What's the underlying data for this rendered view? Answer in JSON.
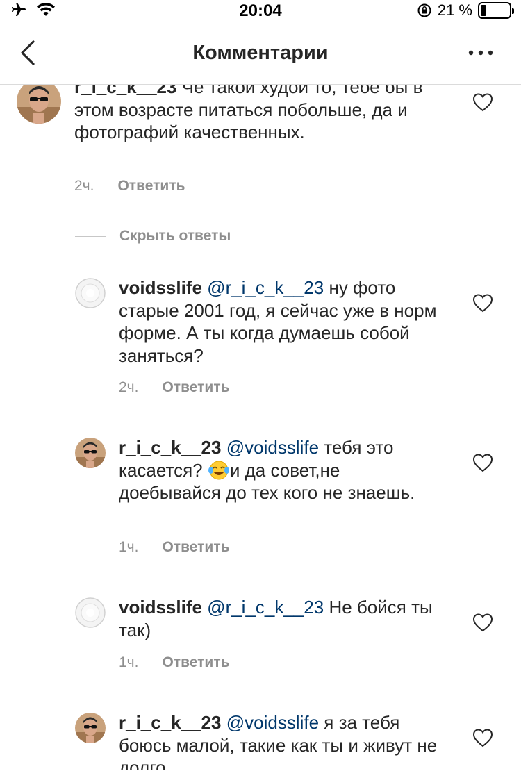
{
  "status_bar": {
    "time": "20:04",
    "battery_text": "21 %",
    "battery_level": 0.21,
    "icons": [
      "airplane-icon",
      "wifi-icon",
      "orientation-lock-icon",
      "battery-icon"
    ]
  },
  "header": {
    "title": "Комментарии",
    "back_icon": "chevron-left-icon",
    "more_icon": "more-horizontal-icon"
  },
  "comments": [
    {
      "username": "r_i_c_k__23",
      "mention": "",
      "text": " Че такой худой то, тебе бы в этом возрасте питаться побольше, да и фотографий качественных.",
      "time": "2ч.",
      "reply_label": "Ответить"
    }
  ],
  "hide_replies_label": "Скрыть ответы",
  "replies": [
    {
      "username": "voidsslife",
      "mention": "@r_i_c_k__23",
      "text": " ну фото старые 2001 год, я сейчас уже в норм форме. А ты когда думаешь собой заняться?",
      "time": "2ч.",
      "reply_label": "Ответить"
    },
    {
      "username": "r_i_c_k__23",
      "mention": "@voidsslife",
      "text_before_emoji": " тебя это касается? ",
      "emoji": "face-with-tears-of-joy-emoji",
      "text_after_emoji": "и да совет,не доебывайся до тех кого не знаешь.",
      "time": "1ч.",
      "reply_label": "Ответить"
    },
    {
      "username": "voidsslife",
      "mention": "@r_i_c_k__23",
      "text": " Не бойся ты так)",
      "time": "1ч.",
      "reply_label": "Ответить"
    },
    {
      "username": "r_i_c_k__23",
      "mention": "@voidsslife",
      "text": " я за тебя боюсь малой, такие как ты и живут не долго.",
      "time": "",
      "reply_label": ""
    }
  ],
  "colors": {
    "text": "#262626",
    "secondary": "#8e8e8e",
    "mention": "#00376b",
    "divider": "#dbdbdb"
  }
}
